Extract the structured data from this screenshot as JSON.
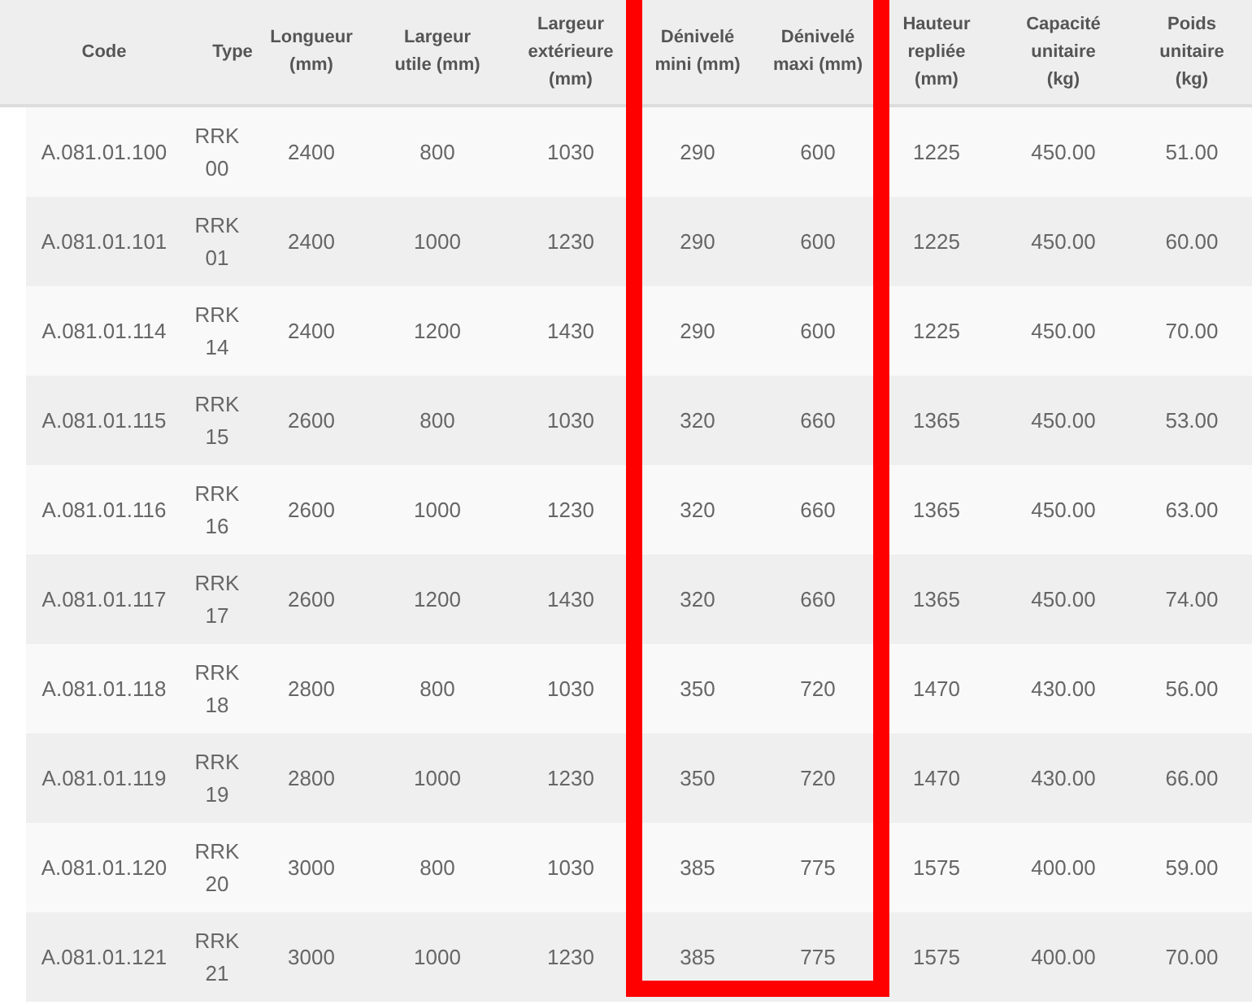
{
  "table": {
    "columns": [
      {
        "label": "Code",
        "highlighted": false
      },
      {
        "label": "Type",
        "highlighted": false
      },
      {
        "label": "Longueur (mm)",
        "highlighted": false
      },
      {
        "label": "Largeur utile (mm)",
        "highlighted": false
      },
      {
        "label": "Largeur extérieure (mm)",
        "highlighted": false
      },
      {
        "label": "Dénivelé mini (mm)",
        "highlighted": true
      },
      {
        "label": "Dénivelé maxi (mm)",
        "highlighted": true
      },
      {
        "label": "Hauteur repliée (mm)",
        "highlighted": false
      },
      {
        "label": "Capacité unitaire (kg)",
        "highlighted": false
      },
      {
        "label": "Poids unitaire (kg)",
        "highlighted": false
      }
    ],
    "rows": [
      [
        "A.081.01.100",
        "RRK 00",
        "2400",
        "800",
        "1030",
        "290",
        "600",
        "1225",
        "450.00",
        "51.00"
      ],
      [
        "A.081.01.101",
        "RRK 01",
        "2400",
        "1000",
        "1230",
        "290",
        "600",
        "1225",
        "450.00",
        "60.00"
      ],
      [
        "A.081.01.114",
        "RRK 14",
        "2400",
        "1200",
        "1430",
        "290",
        "600",
        "1225",
        "450.00",
        "70.00"
      ],
      [
        "A.081.01.115",
        "RRK 15",
        "2600",
        "800",
        "1030",
        "320",
        "660",
        "1365",
        "450.00",
        "53.00"
      ],
      [
        "A.081.01.116",
        "RRK 16",
        "2600",
        "1000",
        "1230",
        "320",
        "660",
        "1365",
        "450.00",
        "63.00"
      ],
      [
        "A.081.01.117",
        "RRK 17",
        "2600",
        "1200",
        "1430",
        "320",
        "660",
        "1365",
        "450.00",
        "74.00"
      ],
      [
        "A.081.01.118",
        "RRK 18",
        "2800",
        "800",
        "1030",
        "350",
        "720",
        "1470",
        "430.00",
        "56.00"
      ],
      [
        "A.081.01.119",
        "RRK 19",
        "2800",
        "1000",
        "1230",
        "350",
        "720",
        "1470",
        "430.00",
        "66.00"
      ],
      [
        "A.081.01.120",
        "RRK 20",
        "3000",
        "800",
        "1030",
        "385",
        "775",
        "1575",
        "400.00",
        "59.00"
      ],
      [
        "A.081.01.121",
        "RRK 21",
        "3000",
        "1000",
        "1230",
        "385",
        "775",
        "1575",
        "400.00",
        "70.00"
      ]
    ]
  }
}
